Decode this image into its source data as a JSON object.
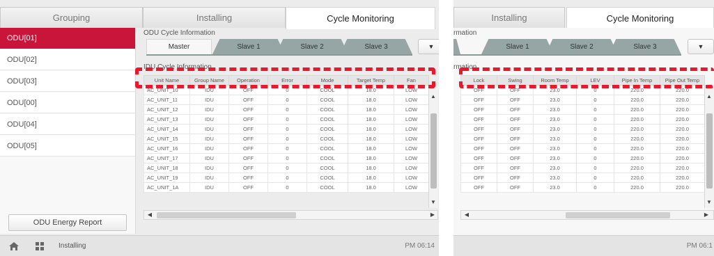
{
  "left": {
    "tabs": [
      "Grouping",
      "Installing",
      "Cycle Monitoring"
    ],
    "active_tab": "Cycle Monitoring",
    "sidebar": {
      "items": [
        "ODU[01]",
        "ODU[02]",
        "ODU[03]",
        "ODU[00]",
        "ODU[04]",
        "ODU[05]"
      ],
      "active": "ODU[01]",
      "energy_button": "ODU Energy Report"
    },
    "odu_title": "ODU Cycle Information",
    "idu_title": "IDU Cycle Information",
    "subtabs": [
      "Master",
      "Slave 1",
      "Slave 2",
      "Slave 3"
    ],
    "dropdown_glyph": "▼",
    "table": {
      "headers": [
        "Unit Name",
        "Group Name",
        "Operation",
        "Error",
        "Mode",
        "Target Temp",
        "Fan"
      ],
      "rows": [
        [
          "AC_UNIT_10",
          "IDU",
          "OFF",
          "0",
          "COOL",
          "18.0",
          "LOW"
        ],
        [
          "AC_UNIT_11",
          "IDU",
          "OFF",
          "0",
          "COOL",
          "18.0",
          "LOW"
        ],
        [
          "AC_UNIT_12",
          "IDU",
          "OFF",
          "0",
          "COOL",
          "18.0",
          "LOW"
        ],
        [
          "AC_UNIT_13",
          "IDU",
          "OFF",
          "0",
          "COOL",
          "18.0",
          "LOW"
        ],
        [
          "AC_UNIT_14",
          "IDU",
          "OFF",
          "0",
          "COOL",
          "18.0",
          "LOW"
        ],
        [
          "AC_UNIT_15",
          "IDU",
          "OFF",
          "0",
          "COOL",
          "18.0",
          "LOW"
        ],
        [
          "AC_UNIT_16",
          "IDU",
          "OFF",
          "0",
          "COOL",
          "18.0",
          "LOW"
        ],
        [
          "AC_UNIT_17",
          "IDU",
          "OFF",
          "0",
          "COOL",
          "18.0",
          "LOW"
        ],
        [
          "AC_UNIT_18",
          "IDU",
          "OFF",
          "0",
          "COOL",
          "18.0",
          "LOW"
        ],
        [
          "AC_UNIT_19",
          "IDU",
          "OFF",
          "0",
          "COOL",
          "18.0",
          "LOW"
        ],
        [
          "AC_UNIT_1A",
          "IDU",
          "OFF",
          "0",
          "COOL",
          "18.0",
          "LOW"
        ]
      ]
    },
    "status": {
      "breadcrumb": "Installing",
      "time": "PM 06:14"
    }
  },
  "right": {
    "tabs": [
      "Installing",
      "Cycle Monitoring"
    ],
    "active_tab": "Cycle Monitoring",
    "odu_title": "rmation",
    "idu_title": "rmation",
    "subtabs": [
      "Slave 1",
      "Slave 2",
      "Slave 3"
    ],
    "dropdown_glyph": "▼",
    "table": {
      "headers": [
        "Lock",
        "Swing",
        "Room Temp",
        "LEV",
        "Pipe In Temp",
        "Pipe Out Temp"
      ],
      "rows": [
        [
          "OFF",
          "OFF",
          "23.0",
          "0",
          "220.0",
          "220.0"
        ],
        [
          "OFF",
          "OFF",
          "23.0",
          "0",
          "220.0",
          "220.0"
        ],
        [
          "OFF",
          "OFF",
          "23.0",
          "0",
          "220.0",
          "220.0"
        ],
        [
          "OFF",
          "OFF",
          "23.0",
          "0",
          "220.0",
          "220.0"
        ],
        [
          "OFF",
          "OFF",
          "23.0",
          "0",
          "220.0",
          "220.0"
        ],
        [
          "OFF",
          "OFF",
          "23.0",
          "0",
          "220.0",
          "220.0"
        ],
        [
          "OFF",
          "OFF",
          "23.0",
          "0",
          "220.0",
          "220.0"
        ],
        [
          "OFF",
          "OFF",
          "23.0",
          "0",
          "220.0",
          "220.0"
        ],
        [
          "OFF",
          "OFF",
          "23.0",
          "0",
          "220.0",
          "220.0"
        ],
        [
          "OFF",
          "OFF",
          "23.0",
          "0",
          "220.0",
          "220.0"
        ],
        [
          "OFF",
          "OFF",
          "23.0",
          "0",
          "220.0",
          "220.0"
        ]
      ]
    },
    "status": {
      "time": "PM 06:1"
    }
  },
  "colors": {
    "accent": "#c9153a",
    "highlight_dash": "#e8192c",
    "subtab_fill": "#95a6a4"
  },
  "icons": {
    "home": "home-icon",
    "grid": "grid-icon",
    "scroll_up": "scroll-up-arrow-icon",
    "scroll_down": "scroll-down-arrow-icon",
    "scroll_left": "scroll-left-arrow-icon",
    "scroll_right": "scroll-right-arrow-icon"
  }
}
